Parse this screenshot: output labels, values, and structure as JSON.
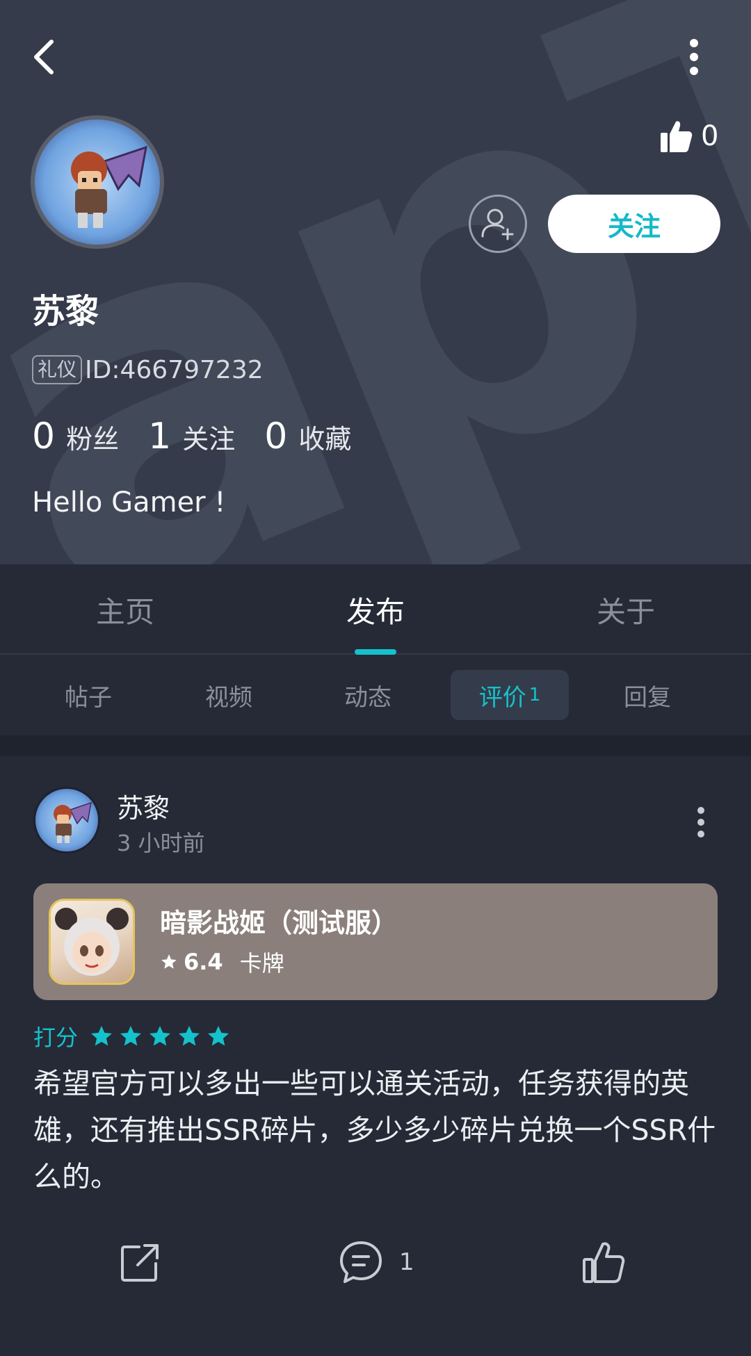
{
  "header": {
    "watermark": "apTa",
    "likes": "0",
    "follow_label": "关注"
  },
  "profile": {
    "name": "苏黎",
    "badge": "礼仪",
    "id_text": "ID:466797232",
    "stats": [
      {
        "num": "0",
        "label": "粉丝"
      },
      {
        "num": "1",
        "label": "关注"
      },
      {
        "num": "0",
        "label": "收藏"
      }
    ],
    "bio": "Hello Gamer !"
  },
  "main_tabs": [
    {
      "label": "主页"
    },
    {
      "label": "发布"
    },
    {
      "label": "关于"
    }
  ],
  "sub_tabs": [
    {
      "label": "帖子"
    },
    {
      "label": "视频"
    },
    {
      "label": "动态"
    },
    {
      "label": "评价",
      "count": "1"
    },
    {
      "label": "回复"
    }
  ],
  "post": {
    "author": "苏黎",
    "time": "3 小时前",
    "game": {
      "name": "暗影战姬（测试服）",
      "rating": "6.4",
      "genre": "卡牌"
    },
    "score_label": "打分",
    "stars": 5,
    "text": "希望官方可以多出一些可以通关活动，任务获得的英雄，还有推出SSR碎片，多少多少碎片兑换一个SSR什么的。",
    "comment_count": "1"
  },
  "colors": {
    "accent": "#14c2cc",
    "header_bg": "#353b4a",
    "page_bg": "#252a36",
    "card_bg": "#8a7f7b"
  }
}
